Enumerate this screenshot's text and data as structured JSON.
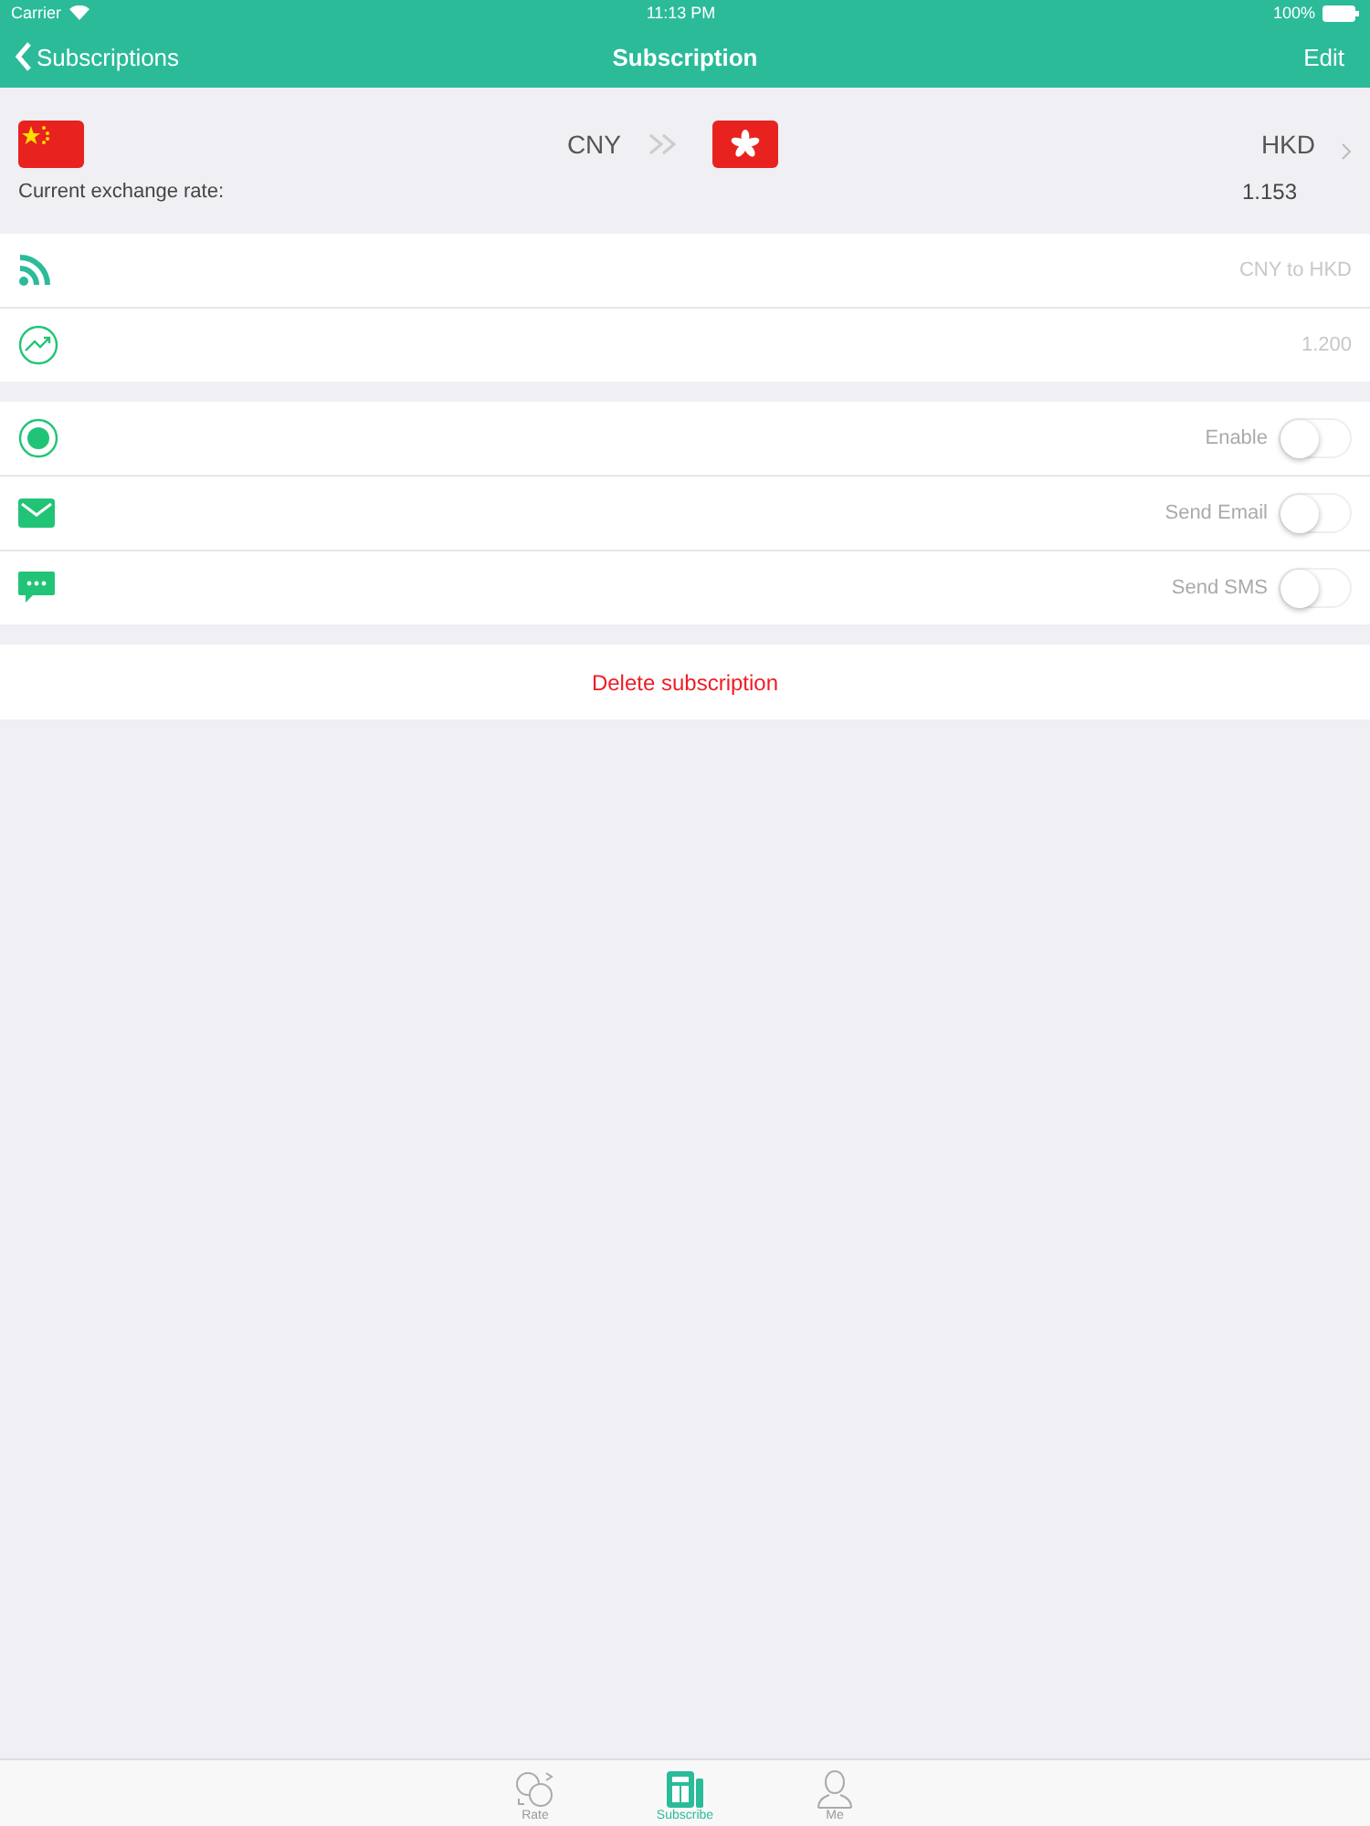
{
  "status_bar": {
    "carrier": "Carrier",
    "time": "11:13 PM",
    "battery": "100%"
  },
  "nav": {
    "back": "Subscriptions",
    "title": "Subscription",
    "action": "Edit"
  },
  "pair": {
    "from": "CNY",
    "to": "HKD",
    "rate_label": "Current exchange rate:",
    "rate": "1.153"
  },
  "info_rows": [
    {
      "kind": "feed",
      "value": "CNY to HKD"
    },
    {
      "kind": "trend",
      "value": "1.200"
    }
  ],
  "toggles": [
    {
      "kind": "enable",
      "label": "Enable",
      "on": false
    },
    {
      "kind": "email",
      "label": "Send Email",
      "on": false
    },
    {
      "kind": "sms",
      "label": "Send SMS",
      "on": false
    }
  ],
  "delete_label": "Delete subscription",
  "tabs": [
    {
      "kind": "rate",
      "label": "Rate",
      "selected": false
    },
    {
      "kind": "subscribe",
      "label": "Subscribe",
      "selected": true
    },
    {
      "kind": "me",
      "label": "Me",
      "selected": false
    }
  ]
}
